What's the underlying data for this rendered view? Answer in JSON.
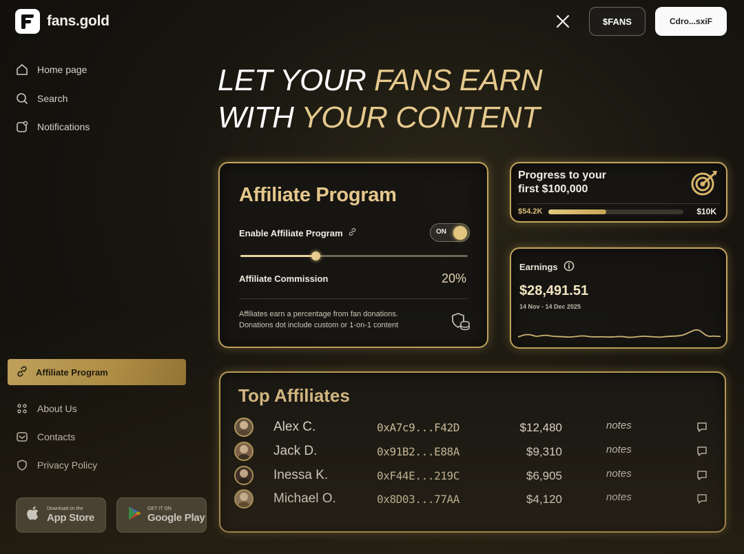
{
  "brand": {
    "name": "fans.gold"
  },
  "header": {
    "fans_label": "$FANS",
    "wallet_label": "Cdro...sxiF"
  },
  "sidebar": {
    "top_items": [
      {
        "label": "Home page",
        "icon": "home-icon"
      },
      {
        "label": "Search",
        "icon": "search-icon"
      },
      {
        "label": "Notifications",
        "icon": "notification-icon"
      }
    ],
    "active_item": {
      "label": "Affiliate Program",
      "icon": "link-icon"
    },
    "bottom_items": [
      {
        "label": "About Us",
        "icon": "dots-grid-icon"
      },
      {
        "label": "Contacts",
        "icon": "mail-icon"
      },
      {
        "label": "Privacy Policy",
        "icon": "shield-icon"
      }
    ],
    "app_store": {
      "small": "Download on the",
      "big": "App Store"
    },
    "google_play": {
      "small": "GET IT ON",
      "big": "Google Play"
    }
  },
  "hero": {
    "line1_white": "LET YOUR ",
    "line1_gold": "FANS EARN",
    "line2_white": "WITH ",
    "line2_gold": "YOUR CONTENT"
  },
  "affiliate_card": {
    "title": "Affiliate Program",
    "enable_label": "Enable Affiliate Program",
    "toggle_label": "ON",
    "toggle_on": true,
    "commission_label": "Affiliate Commission",
    "commission_value": "20%",
    "commission_fraction": 0.33,
    "note": "Affiliates earn a percentage from fan donations. Donations dot include custom or 1-on-1 content"
  },
  "progress_card": {
    "title": "Progress to your first $100,000",
    "start_label": "$54.2K",
    "end_label": "$10K",
    "fill_fraction": 0.43
  },
  "earnings_card": {
    "label": "Earnings",
    "amount": "$28,491.51",
    "range": "14 Nov - 14 Dec 2025"
  },
  "top_affiliates": {
    "title": "Top Affiliates",
    "rows": [
      {
        "name": "Alex C.",
        "address": "0xA7c9...F42D",
        "amount": "$12,480",
        "notes": "notes"
      },
      {
        "name": "Jack D.",
        "address": "0x91B2...E88A",
        "amount": "$9,310",
        "notes": "notes"
      },
      {
        "name": "Inessa K.",
        "address": "0xF44E...219C",
        "amount": "$6,905",
        "notes": "notes"
      },
      {
        "name": "Michael O.",
        "address": "0x8D03...77AA",
        "amount": "$4,120",
        "notes": "notes"
      }
    ]
  },
  "colors": {
    "gold": "#e5c78c",
    "accent": "#c9a960",
    "background": "#17150f"
  }
}
